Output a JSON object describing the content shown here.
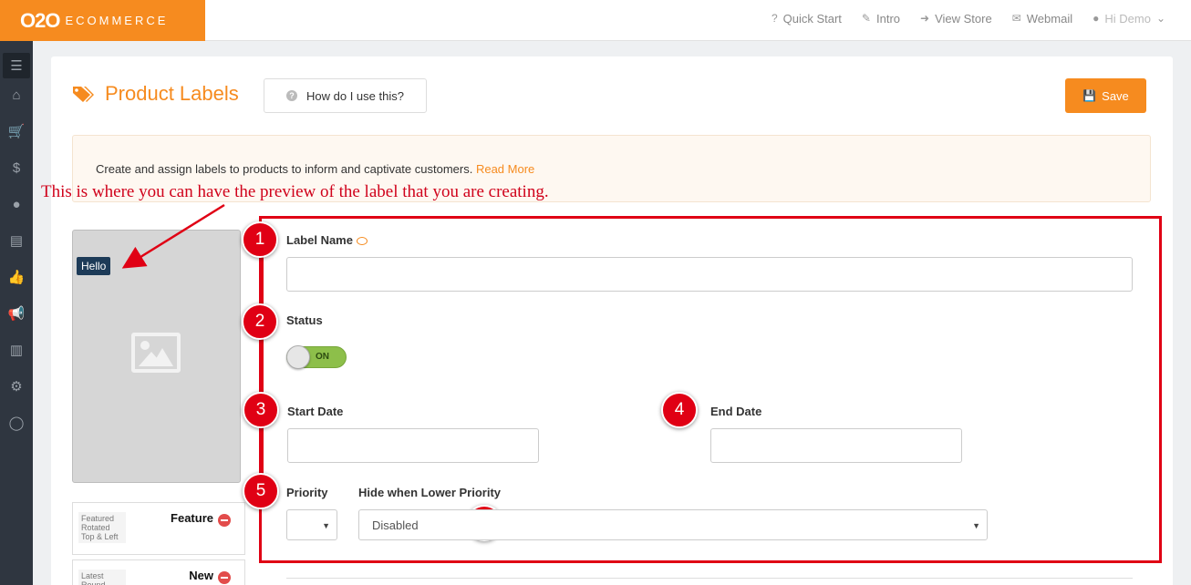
{
  "brand": {
    "mark": "O2O",
    "text": "ECOMMERCE"
  },
  "topnav": [
    {
      "label": "Quick Start",
      "icon": "question-icon"
    },
    {
      "label": "Intro",
      "icon": "magic-wand-icon"
    },
    {
      "label": "View Store",
      "icon": "sign-in-icon"
    },
    {
      "label": "Webmail",
      "icon": "envelope-icon"
    },
    {
      "label": "Hi Demo",
      "icon": "user-icon"
    }
  ],
  "sidebar": [
    "menu-icon",
    "home-icon",
    "cart-icon",
    "dollar-icon",
    "user-icon",
    "book-icon",
    "thumbs-up-icon",
    "megaphone-icon",
    "bar-chart-icon",
    "cogs-icon",
    "chat-icon"
  ],
  "page": {
    "title": "Product Labels",
    "help_label": "How do I use this?",
    "save_label": "Save",
    "info_text": "Create and assign labels to products to inform and captivate customers.",
    "info_link": "Read More"
  },
  "annotation": "This is where you can have the preview of the label that you are creating.",
  "preview": {
    "tag_text": "Hello"
  },
  "label_list": [
    {
      "name": "Feature",
      "thumb": "Featured Rotated Top & Left"
    },
    {
      "name": "New",
      "thumb": "Latest Round"
    }
  ],
  "form": {
    "steps": [
      "1",
      "2",
      "3",
      "4",
      "5",
      "6"
    ],
    "label_name": "Label Name",
    "label_name_value": "",
    "status": "Status",
    "status_toggle": "ON",
    "start_date": "Start Date",
    "start_date_value": "",
    "end_date": "End Date",
    "end_date_value": "",
    "priority": "Priority",
    "priority_value": "",
    "hide_lower": "Hide when Lower Priority",
    "hide_lower_value": "Disabled"
  },
  "colors": {
    "accent": "#f68b1f",
    "annotation": "#e00014",
    "sidebar": "#2f3640"
  }
}
